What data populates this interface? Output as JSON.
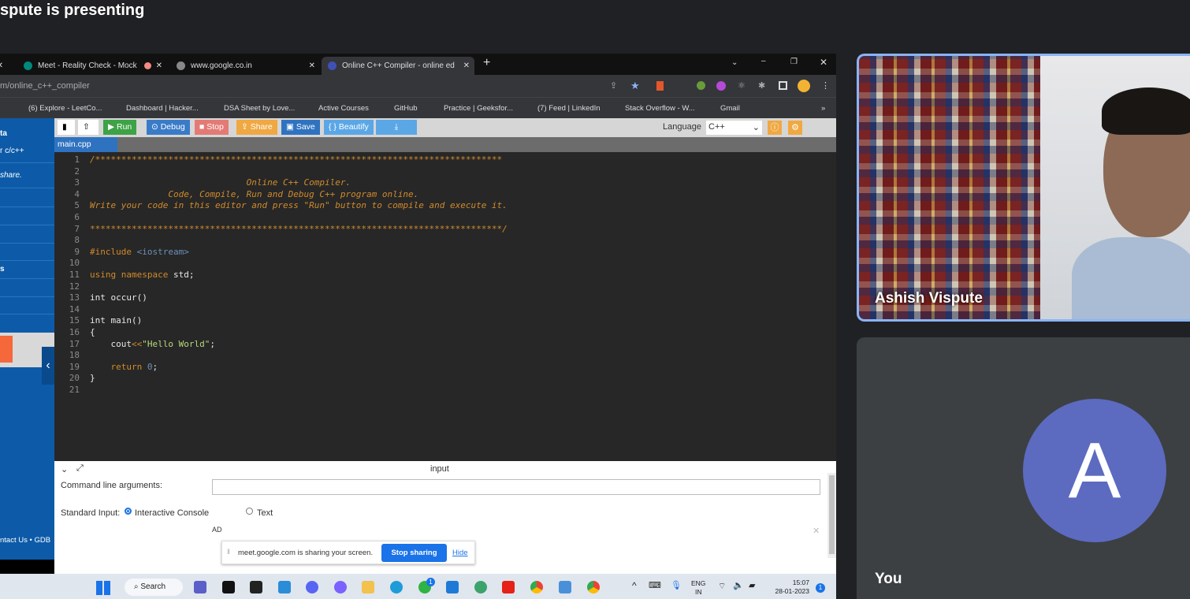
{
  "meet": {
    "presenting_title": "spute is presenting",
    "participant_name": "Ashish Vispute",
    "you_label": "You",
    "avatar_letter": "A",
    "avatar_color": "#5c6bc0"
  },
  "browser": {
    "tabs": [
      {
        "label": "Meet - Reality Check - Mock"
      },
      {
        "label": "www.google.co.in"
      },
      {
        "label": "Online C++ Compiler - online ed"
      }
    ],
    "url": "m/online_c++_compiler",
    "bookmarks": [
      "(6) Explore - LeetCo...",
      "Dashboard | Hacker...",
      "DSA Sheet by Love...",
      "Active Courses",
      "GitHub",
      "Practice | Geeksfor...",
      "(7) Feed | LinkedIn",
      "Stack Overflow - W...",
      "Gmail"
    ]
  },
  "sidebar": {
    "items": [
      "ta",
      "r c/c++",
      "share.",
      "s"
    ],
    "footer": "ntact Us • GDB"
  },
  "toolbar": {
    "run": "Run",
    "debug": "Debug",
    "stop": "Stop",
    "share": "Share",
    "save": "Save",
    "beautify": "{ } Beautify",
    "language_label": "Language",
    "language_value": "C++"
  },
  "file_tab": "main.cpp",
  "code": [
    [
      [
        "/******************************************************************************",
        "cm"
      ]
    ],
    [],
    [
      [
        "                              Online C++ Compiler.",
        "cm"
      ]
    ],
    [
      [
        "               Code, Compile, Run and Debug C++ program online.",
        "cm"
      ]
    ],
    [
      [
        "Write your code in this editor and press \"Run\" button to compile and execute it.",
        "cm"
      ]
    ],
    [],
    [
      [
        "*******************************************************************************/",
        "cm"
      ]
    ],
    [],
    [
      [
        "#include ",
        "kw"
      ],
      [
        "<iostream>",
        "inc"
      ]
    ],
    [],
    [
      [
        "using namespace ",
        "kw"
      ],
      [
        "std;",
        "tx"
      ]
    ],
    [],
    [
      [
        "int occur(",
        "tx"
      ],
      [
        ")",
        "tx"
      ]
    ],
    [],
    [
      [
        "int main()",
        "tx"
      ]
    ],
    [
      [
        "{",
        "tx"
      ]
    ],
    [
      [
        "    cout",
        "tx"
      ],
      [
        "<<",
        "op"
      ],
      [
        "\"Hello World\"",
        "str"
      ],
      [
        ";",
        "tx"
      ]
    ],
    [],
    [
      [
        "    return ",
        "kw"
      ],
      [
        "0",
        "num"
      ],
      [
        ";",
        "tx"
      ]
    ],
    [
      [
        "}",
        "tx"
      ]
    ],
    []
  ],
  "input_panel": {
    "title": "input",
    "cmd_label": "Command line arguments:",
    "cmd_value": "",
    "stdin_label": "Standard Input:",
    "opt_console": "Interactive Console",
    "opt_text": "Text",
    "ad": "AD"
  },
  "share_bar": {
    "message": "meet.google.com is sharing your screen.",
    "stop": "Stop sharing",
    "hide": "Hide"
  },
  "taskbar": {
    "search": "Search",
    "lang_top": "ENG",
    "lang_bottom": "IN",
    "time": "15:07",
    "date": "28-01-2023",
    "notif": "1",
    "whatsapp_badge": "1"
  }
}
